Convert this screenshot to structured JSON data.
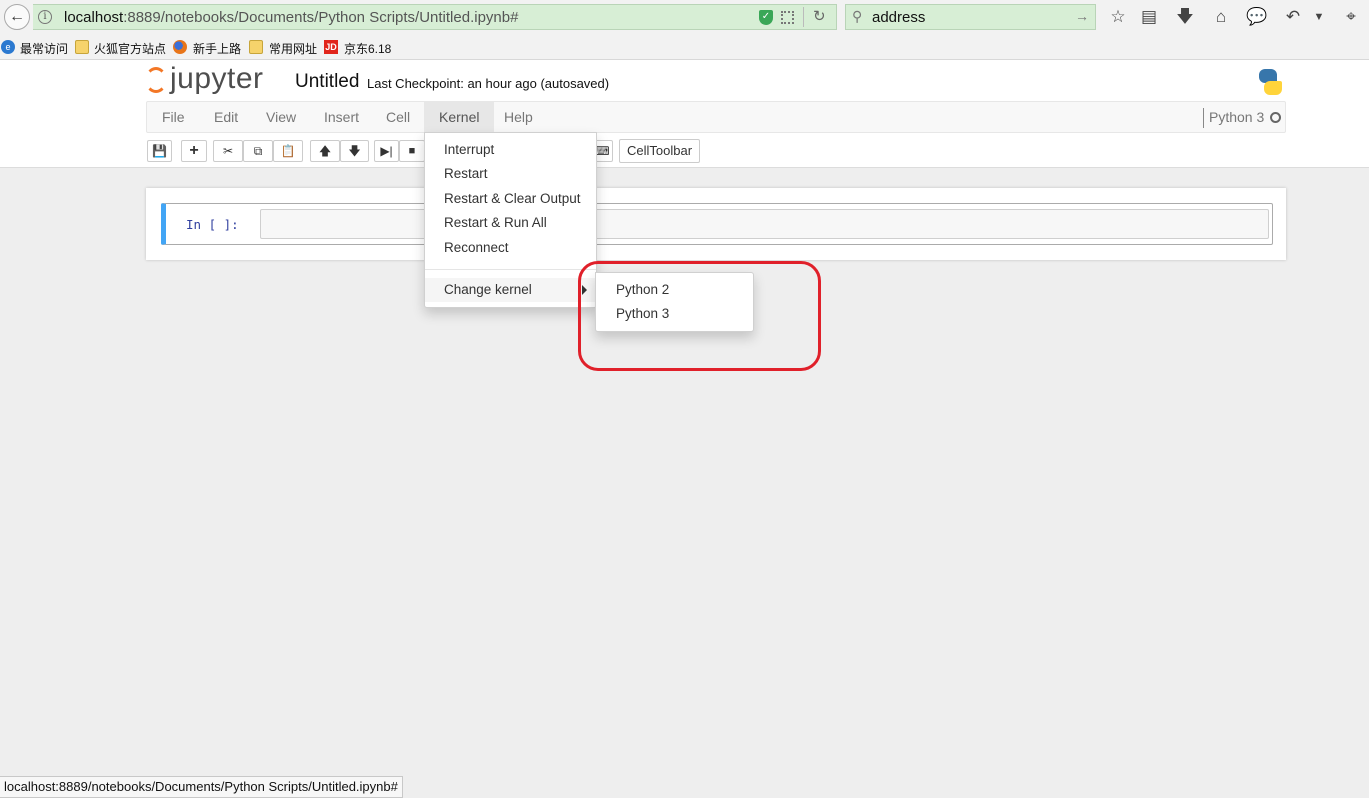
{
  "browser": {
    "url_host": "localhost",
    "url_rest": ":8889/notebooks/Documents/Python Scripts/Untitled.ipynb#",
    "search_text": "address",
    "bookmarks": [
      "最常访问",
      "火狐官方站点",
      "新手上路",
      "常用网址",
      "京东6.18"
    ],
    "bookmark_icon_labels": {
      "jd": "JD"
    }
  },
  "header": {
    "logo_text": "jupyter",
    "notebook_title": "Untitled",
    "checkpoint": "Last Checkpoint: an hour ago (autosaved)"
  },
  "menubar": {
    "items": [
      "File",
      "Edit",
      "View",
      "Insert",
      "Cell",
      "Kernel",
      "Help"
    ],
    "active": "Kernel",
    "kernel_name": "Python 3"
  },
  "toolbar": {
    "celltoolbar_label": "CellToolbar"
  },
  "cell": {
    "prompt": "In [ ]:"
  },
  "kernel_menu": {
    "items": [
      "Interrupt",
      "Restart",
      "Restart & Clear Output",
      "Restart & Run All",
      "Reconnect"
    ],
    "change_kernel": "Change kernel",
    "submenu": [
      "Python 2",
      "Python 3"
    ]
  },
  "status_bar": {
    "text": "localhost:8889/notebooks/Documents/Python Scripts/Untitled.ipynb#"
  },
  "colors": {
    "accent": "#42a5f5",
    "highlight": "#e0202a",
    "jupyter_orange": "#f37726"
  }
}
